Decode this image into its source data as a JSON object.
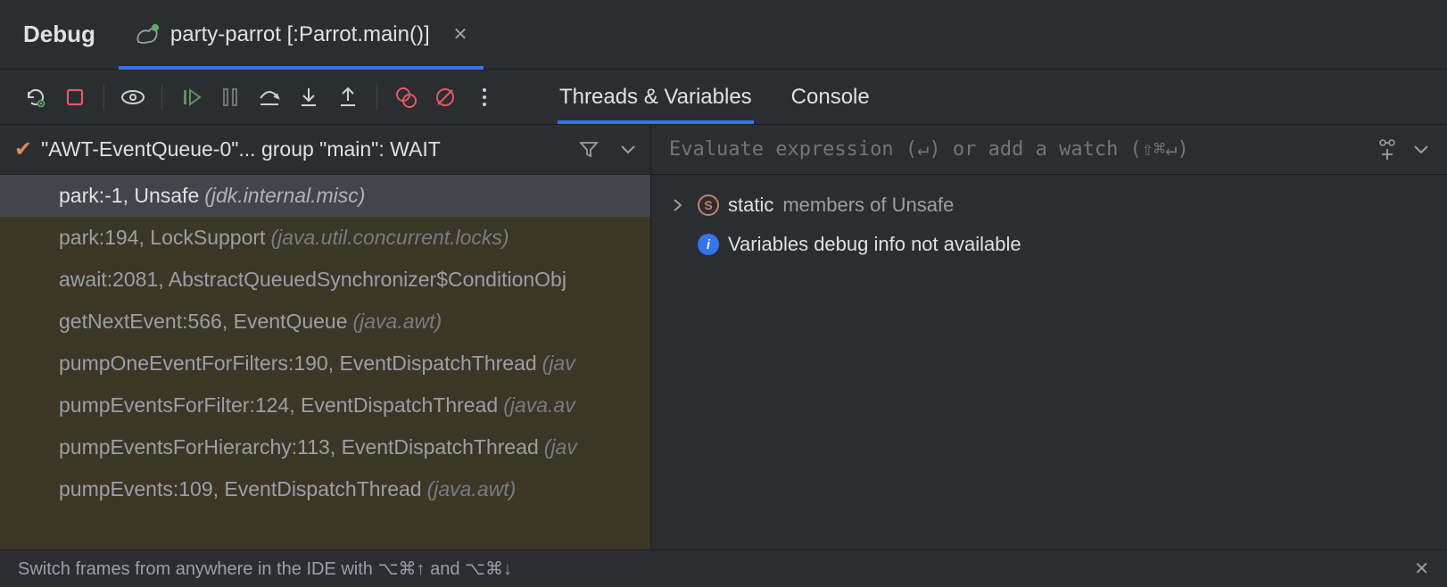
{
  "header": {
    "title": "Debug"
  },
  "run_tab": {
    "label": "party-parrot [:Parrot.main()]"
  },
  "sub_tabs": {
    "threads": "Threads & Variables",
    "console": "Console",
    "active": "threads"
  },
  "thread": {
    "label": "\"AWT-EventQueue-0\"... group \"main\": WAIT"
  },
  "frames": [
    {
      "method": "park:-1, Unsafe",
      "pkg": "(jdk.internal.misc)",
      "selected": true
    },
    {
      "method": "park:194, LockSupport",
      "pkg": "(java.util.concurrent.locks)"
    },
    {
      "method": "await:2081, AbstractQueuedSynchronizer$ConditionObj",
      "pkg": ""
    },
    {
      "method": "getNextEvent:566, EventQueue",
      "pkg": "(java.awt)"
    },
    {
      "method": "pumpOneEventForFilters:190, EventDispatchThread",
      "pkg": "(jav"
    },
    {
      "method": "pumpEventsForFilter:124, EventDispatchThread",
      "pkg": "(java.av"
    },
    {
      "method": "pumpEventsForHierarchy:113, EventDispatchThread",
      "pkg": "(jav"
    },
    {
      "method": "pumpEvents:109, EventDispatchThread",
      "pkg": "(java.awt)"
    }
  ],
  "eval": {
    "placeholder": "Evaluate expression (↵) or add a watch (⇧⌘↵)"
  },
  "variables": {
    "static_label": "static",
    "static_rest": "members of Unsafe",
    "info_message": "Variables debug info not available"
  },
  "footer": {
    "hint": "Switch frames from anywhere in the IDE with ⌥⌘↑ and ⌥⌘↓"
  }
}
